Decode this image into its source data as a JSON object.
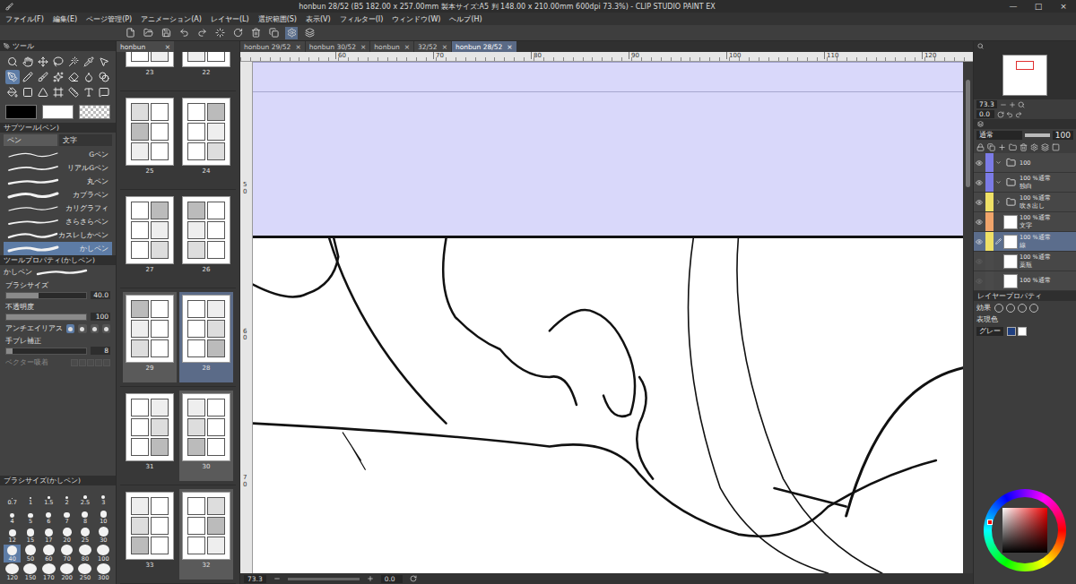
{
  "window": {
    "title": "honbun 28/52 (B5 182.00 x 257.00mm 製本サイズ:A5 判 148.00 x 210.00mm 600dpi 73.3%) - CLIP STUDIO PAINT EX",
    "controls": [
      "—",
      "□",
      "×"
    ]
  },
  "menu": [
    "ファイル(F)",
    "編集(E)",
    "ページ管理(P)",
    "アニメーション(A)",
    "レイヤー(L)",
    "選択範囲(S)",
    "表示(V)",
    "フィルター(I)",
    "ウィンドウ(W)",
    "ヘルプ(H)"
  ],
  "tool_panel": {
    "title": "ツール"
  },
  "sub_tool": {
    "title": "サブツール(ペン)",
    "tabs": [
      {
        "label": "ペン",
        "selected": true
      },
      {
        "label": "文字",
        "selected": false
      }
    ],
    "items": [
      {
        "label": "Gペン",
        "selected": false
      },
      {
        "label": "リアルGペン",
        "selected": false
      },
      {
        "label": "丸ペン",
        "selected": false
      },
      {
        "label": "カブラペン",
        "selected": false
      },
      {
        "label": "カリグラフィ",
        "selected": false
      },
      {
        "label": "さらさらペン",
        "selected": false
      },
      {
        "label": "カスレしかペン",
        "selected": false
      },
      {
        "label": "かしペン",
        "selected": true
      }
    ]
  },
  "tool_property": {
    "title": "ツールプロパティ(かしペン)",
    "preset": "かしペン",
    "rows": [
      {
        "label": "ブラシサイズ",
        "kind": "slider",
        "value": "40.0",
        "level": 0.4
      },
      {
        "label": "不透明度",
        "kind": "slider",
        "value": "100",
        "level": 1
      },
      {
        "label": "アンチエイリアス",
        "kind": "segments",
        "segments": [
          {
            "selected": true
          },
          {
            "selected": false
          },
          {
            "selected": false
          },
          {
            "selected": false
          }
        ]
      },
      {
        "label": "手ブレ補正",
        "kind": "slider",
        "value": "8",
        "level": 0.08
      },
      {
        "label": "ベクター吸着",
        "kind": "toggle",
        "disabled": true
      }
    ]
  },
  "brush_size": {
    "title": "ブラシサイズ(かしペン)",
    "sizes": [
      {
        "label": "0.7",
        "selected": false
      },
      {
        "label": "1",
        "selected": false
      },
      {
        "label": "1.5",
        "selected": false
      },
      {
        "label": "2",
        "selected": false
      },
      {
        "label": "2.5",
        "selected": false
      },
      {
        "label": "3",
        "selected": false
      },
      {
        "label": "4",
        "selected": false
      },
      {
        "label": "5",
        "selected": false
      },
      {
        "label": "6",
        "selected": false
      },
      {
        "label": "7",
        "selected": false
      },
      {
        "label": "8",
        "selected": false
      },
      {
        "label": "10",
        "selected": false
      },
      {
        "label": "12",
        "selected": false
      },
      {
        "label": "15",
        "selected": false
      },
      {
        "label": "17",
        "selected": false
      },
      {
        "label": "20",
        "selected": false
      },
      {
        "label": "25",
        "selected": false
      },
      {
        "label": "30",
        "selected": false
      },
      {
        "label": "40",
        "selected": true
      },
      {
        "label": "50",
        "selected": false
      },
      {
        "label": "60",
        "selected": false
      },
      {
        "label": "70",
        "selected": false
      },
      {
        "label": "80",
        "selected": false
      },
      {
        "label": "100",
        "selected": false
      },
      {
        "label": "120",
        "selected": false
      },
      {
        "label": "150",
        "selected": false
      },
      {
        "label": "170",
        "selected": false
      },
      {
        "label": "200",
        "selected": false
      },
      {
        "label": "250",
        "selected": false
      },
      {
        "label": "300",
        "selected": false
      }
    ]
  },
  "page_manager": {
    "tab": "honbun",
    "close": "×",
    "pages": [
      {
        "number": "23",
        "selected": false,
        "highlighted": false
      },
      {
        "number": "22",
        "selected": false,
        "highlighted": false
      },
      {
        "number": "25",
        "selected": false,
        "highlighted": false
      },
      {
        "number": "24",
        "selected": false,
        "highlighted": false
      },
      {
        "number": "27",
        "selected": false,
        "highlighted": false
      },
      {
        "number": "26",
        "selected": false,
        "highlighted": false
      },
      {
        "number": "29",
        "selected": false,
        "highlighted": true
      },
      {
        "number": "28",
        "selected": true,
        "highlighted": true
      },
      {
        "number": "31",
        "selected": false,
        "highlighted": false
      },
      {
        "number": "30",
        "selected": false,
        "highlighted": true
      },
      {
        "number": "33",
        "selected": false,
        "highlighted": false
      },
      {
        "number": "32",
        "selected": false,
        "highlighted": true
      }
    ]
  },
  "canvas_tabs": [
    {
      "label": "honbun 29/52",
      "close": "×",
      "selected": false
    },
    {
      "label": "honbun 30/52",
      "close": "×",
      "selected": false
    },
    {
      "label": "honbun",
      "close": "×",
      "selected": false
    },
    {
      "label": "32/52",
      "close": "×",
      "selected": false
    },
    {
      "label": "honbun 28/52",
      "close": "×",
      "selected": true
    }
  ],
  "ruler": {
    "top": [
      "60",
      "70",
      "80",
      "90",
      "100",
      "110",
      "120"
    ],
    "left": [
      "50",
      "60",
      "70"
    ]
  },
  "status_bar": {
    "zoom": "73.3",
    "angle": "0.0"
  },
  "navigator": {
    "zoom": "73.3",
    "angle": "0.0"
  },
  "layer_panel": {
    "blend": "通常",
    "opacity": "100",
    "layers": [
      {
        "opacity": "100",
        "name": "",
        "kind": "group",
        "visible": true,
        "selected": false,
        "expanded": true,
        "color": "#7b7be6"
      },
      {
        "opacity": "100 %通常",
        "name": "独白",
        "kind": "folder",
        "visible": true,
        "selected": false,
        "expanded": true,
        "color": "#7b7be6"
      },
      {
        "opacity": "100 %通常",
        "name": "吹き出し",
        "kind": "folder",
        "visible": true,
        "selected": false,
        "expanded": false,
        "color": "#efe066"
      },
      {
        "opacity": "100 %通常",
        "name": "文字",
        "kind": "layer",
        "visible": true,
        "selected": false,
        "expanded": false,
        "color": "#f0a46a"
      },
      {
        "opacity": "100 %通常",
        "name": "線",
        "kind": "layer",
        "visible": true,
        "selected": true,
        "expanded": false,
        "color": "#efe066"
      },
      {
        "opacity": "100 %通常",
        "name": "薬瓶",
        "kind": "layer",
        "visible": false,
        "selected": false,
        "expanded": false,
        "color": "#4a4a4a"
      },
      {
        "opacity": "100 %通常",
        "name": "",
        "kind": "layer",
        "visible": false,
        "selected": false,
        "expanded": false,
        "color": "#4a4a4a"
      }
    ]
  },
  "layer_property": {
    "title": "レイヤープロパティ",
    "effect": "効果",
    "expression_label": "表現色",
    "expression_value": "グレー"
  }
}
